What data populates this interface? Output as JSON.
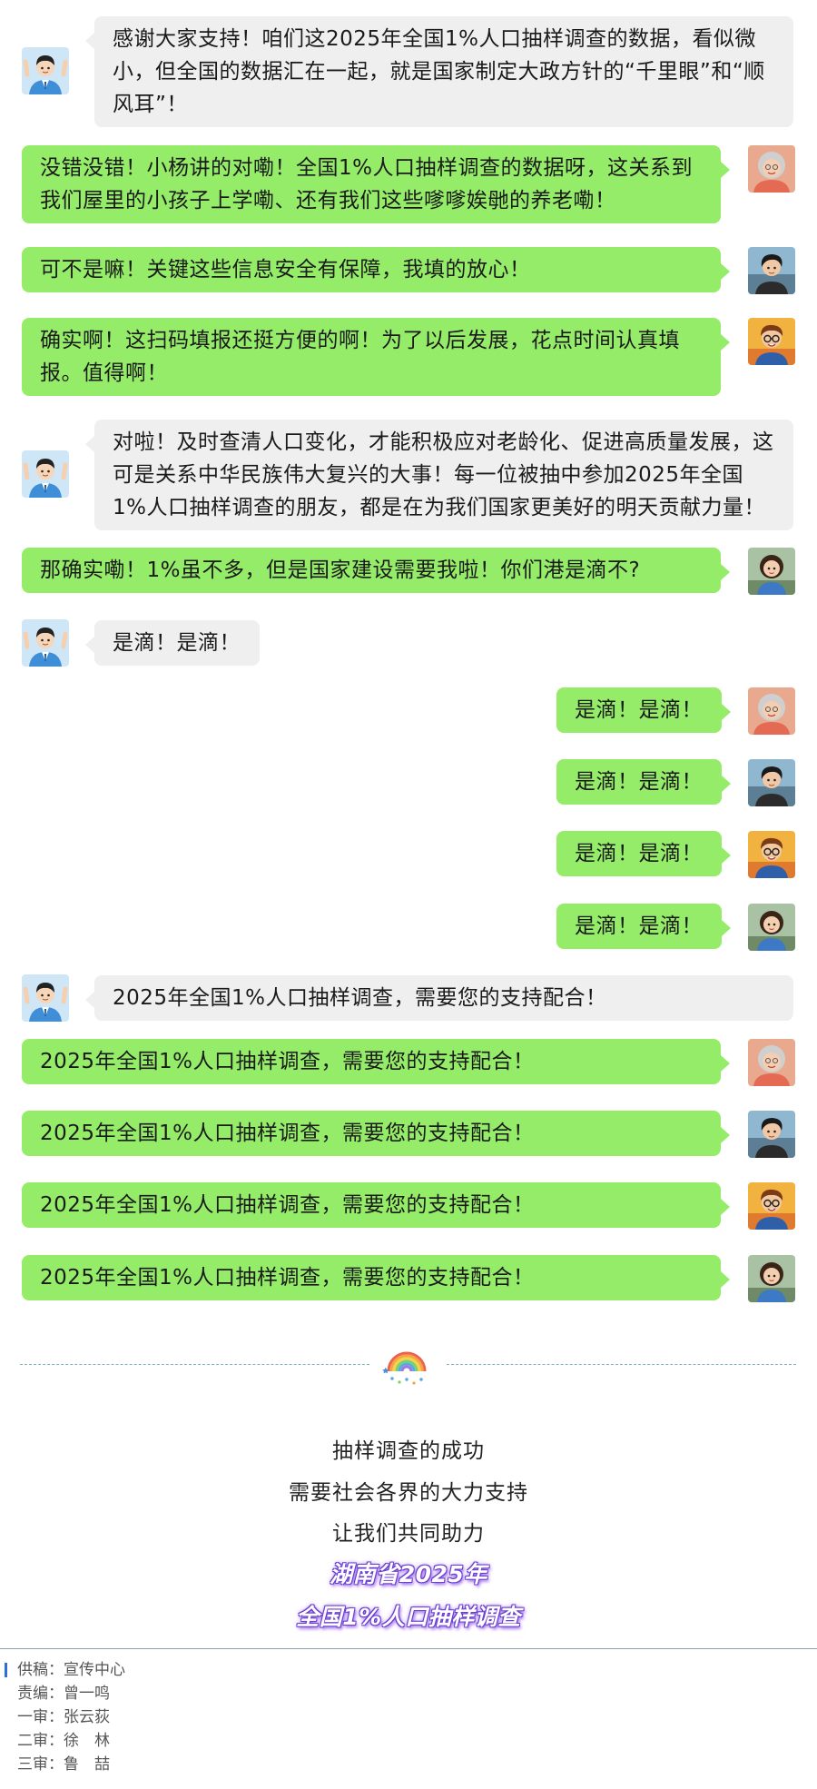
{
  "chat": {
    "messages": [
      {
        "speaker": "official",
        "side": "left",
        "text": "感谢大家支持！咱们这2025年全国1%人口抽样调查的数据，看似微小，但全国的数据汇在一起，就是国家制定大政方针的“千里眼”和“顺风耳”！"
      },
      {
        "speaker": "grandma",
        "side": "right",
        "text": "没错没错！小杨讲的对嘞！全国1%人口抽样调查的数据呀，这关系到我们屋里的小孩子上学嘞、还有我们这些嗲嗲娭毑的养老嘞！"
      },
      {
        "speaker": "young-man",
        "side": "right",
        "text": "可不是嘛！关键这些信息安全有保障，我填的放心！"
      },
      {
        "speaker": "glasses-man",
        "side": "right",
        "text": "确实啊！这扫码填报还挺方便的啊！为了以后发展，花点时间认真填报。值得啊！"
      },
      {
        "speaker": "official",
        "side": "left",
        "text": "对啦！及时查清人口变化，才能积极应对老龄化、促进高质量发展，这可是关系中华民族伟大复兴的大事！每一位被抽中参加2025年全国1%人口抽样调查的朋友，都是在为我们国家更美好的明天贡献力量！"
      },
      {
        "speaker": "young-woman",
        "side": "right",
        "text": "那确实嘞！1%虽不多，但是国家建设需要我啦！你们港是滴不?"
      },
      {
        "speaker": "official",
        "side": "left",
        "text": "是滴！是滴！"
      },
      {
        "speaker": "grandma",
        "side": "right",
        "text": "是滴！是滴！"
      },
      {
        "speaker": "young-man",
        "side": "right",
        "text": "是滴！是滴！"
      },
      {
        "speaker": "glasses-man",
        "side": "right",
        "text": "是滴！是滴！"
      },
      {
        "speaker": "young-woman",
        "side": "right",
        "text": "是滴！是滴！"
      },
      {
        "speaker": "official",
        "side": "left",
        "text": "2025年全国1%人口抽样调查，需要您的支持配合！"
      },
      {
        "speaker": "grandma",
        "side": "right",
        "text": "2025年全国1%人口抽样调查，需要您的支持配合！"
      },
      {
        "speaker": "young-man",
        "side": "right",
        "text": "2025年全国1%人口抽样调查，需要您的支持配合！"
      },
      {
        "speaker": "glasses-man",
        "side": "right",
        "text": "2025年全国1%人口抽样调查，需要您的支持配合！"
      },
      {
        "speaker": "young-woman",
        "side": "right",
        "text": "2025年全国1%人口抽样调查，需要您的支持配合！"
      }
    ]
  },
  "closing": {
    "line1": "抽样调查的成功",
    "line2": "需要社会各界的大力支持",
    "line3": "让我们共同助力",
    "highlight1": "湖南省2025年",
    "highlight2": "全国1%人口抽样调查"
  },
  "credits": [
    {
      "label": "供稿：",
      "value": "宣传中心"
    },
    {
      "label": "责编：",
      "value": "曾一鸣"
    },
    {
      "label": "一审：",
      "value": "张云荻"
    },
    {
      "label": "二审：",
      "value": "徐　林"
    },
    {
      "label": "三审：",
      "value": "鲁　喆"
    }
  ],
  "colors": {
    "green_bubble": "#95ec69",
    "gray_bubble": "#efefef",
    "highlight_glow": "#6a3fd0",
    "divider": "#7fb0b8"
  },
  "icons": {
    "official": "official-avatar-icon",
    "grandma": "grandma-avatar-icon",
    "young-man": "young-man-avatar-icon",
    "glasses-man": "glasses-man-avatar-icon",
    "young-woman": "young-woman-avatar-icon",
    "divider": "rainbow-icon"
  }
}
